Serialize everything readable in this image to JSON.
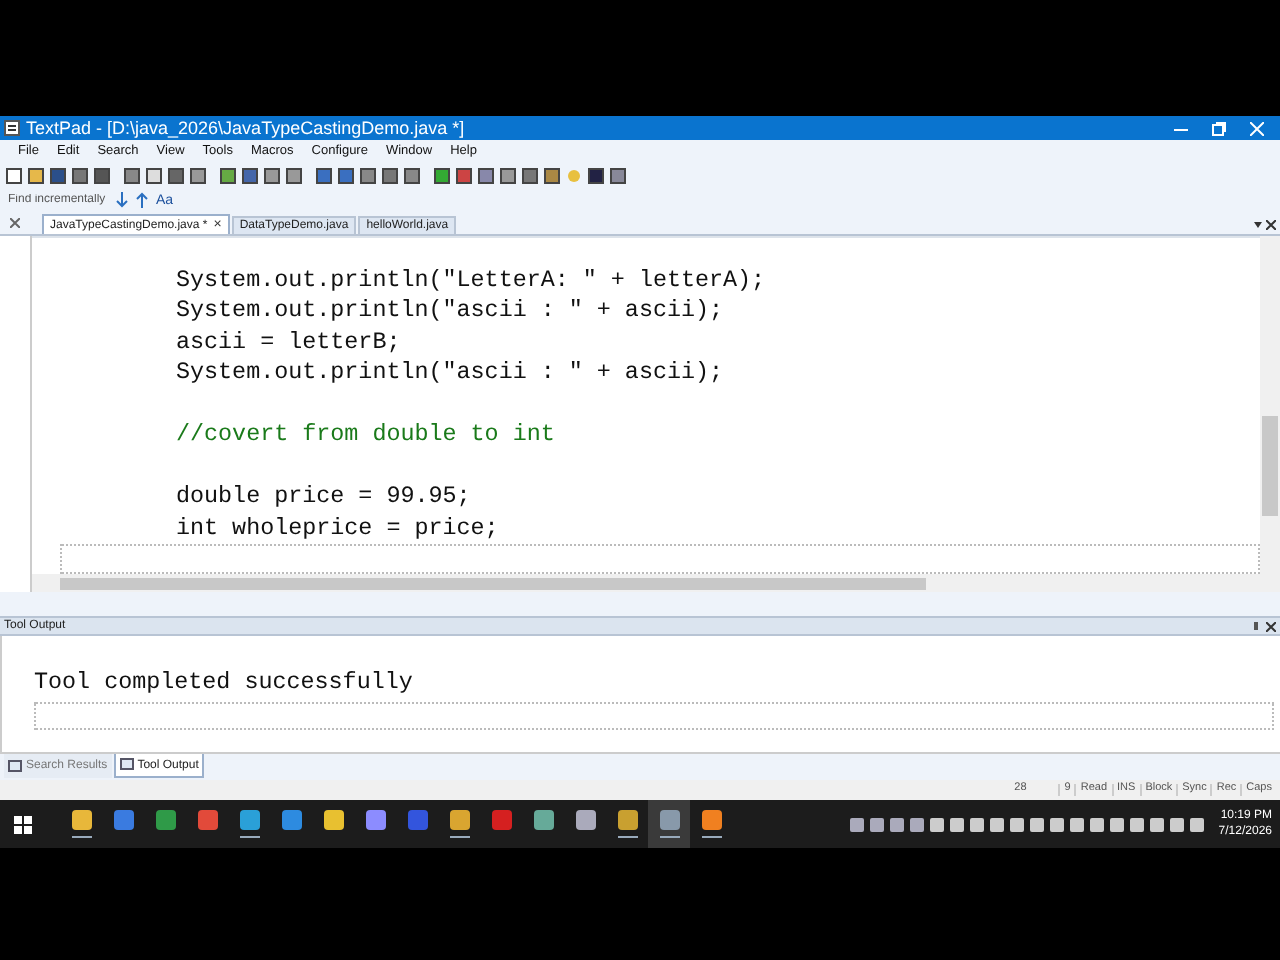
{
  "window": {
    "title": "TextPad - [D:\\java_2026\\JavaTypeCastingDemo.java *]"
  },
  "menu": [
    "File",
    "Edit",
    "Search",
    "View",
    "Tools",
    "Macros",
    "Configure",
    "Window",
    "Help"
  ],
  "find_bar": {
    "placeholder": "Find incrementally",
    "case_button": "Aa"
  },
  "tabs": [
    {
      "label": "JavaTypeCastingDemo.java *",
      "selected": true
    },
    {
      "label": "DataTypeDemo.java",
      "selected": false
    },
    {
      "label": "helloWorld.java",
      "selected": false
    }
  ],
  "tab_close": "×",
  "editor": {
    "lines": [
      {
        "kind": "code",
        "text": "System.out.println(\"LetterA: \" + letterA);"
      },
      {
        "kind": "code",
        "text": "System.out.println(\"ascii : \" + ascii);"
      },
      {
        "kind": "code",
        "text": "ascii = letterB;"
      },
      {
        "kind": "code",
        "text": "System.out.println(\"ascii : \" + ascii);"
      },
      {
        "kind": "blank"
      },
      {
        "kind": "comment",
        "text": "//covert from double to int"
      },
      {
        "kind": "blank"
      },
      {
        "kind": "code",
        "text": "double price = 99.95;"
      },
      {
        "kind": "code",
        "text": "int wholeprice = price;"
      },
      {
        "kind": "current"
      }
    ]
  },
  "output_panel": {
    "title": "Tool Output",
    "text": "Tool completed successfully"
  },
  "panel_tabs": [
    {
      "label": "Search Results",
      "selected": false
    },
    {
      "label": "Tool Output",
      "selected": true
    }
  ],
  "status_bar": [
    "28",
    "9",
    "Read",
    "INS",
    "Block",
    "Sync",
    "Rec",
    "Caps"
  ],
  "taskbar": {
    "apps": [
      {
        "running": true
      },
      {
        "running": false
      },
      {
        "running": false
      },
      {
        "running": false
      },
      {
        "running": true
      },
      {
        "running": false
      },
      {
        "running": false
      },
      {
        "running": false
      },
      {
        "running": false
      },
      {
        "running": true
      },
      {
        "running": false
      },
      {
        "running": false
      },
      {
        "running": false
      },
      {
        "running": true
      },
      {
        "running": true
      },
      {
        "running": true
      }
    ],
    "time": "10:19 PM",
    "date": "7/12/2026"
  }
}
